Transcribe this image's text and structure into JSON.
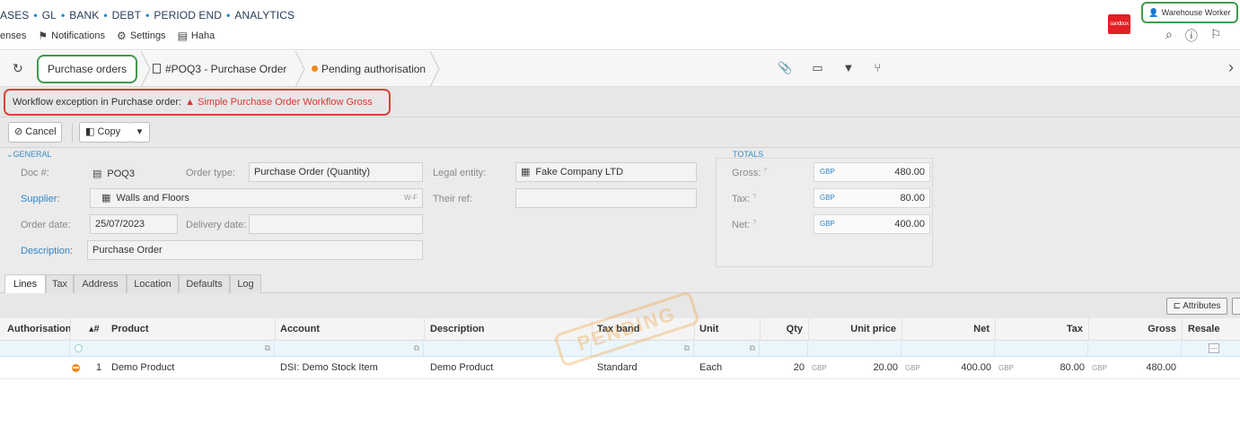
{
  "topnav": {
    "modules": [
      "ASES",
      "GL",
      "BANK",
      "DEBT",
      "PERIOD END",
      "ANALYTICS"
    ],
    "links": [
      {
        "label": "enses",
        "icon": ""
      },
      {
        "label": "Notifications",
        "icon": "flag-icon"
      },
      {
        "label": "Settings",
        "icon": "gear-icon"
      },
      {
        "label": "Haha",
        "icon": "document-icon"
      }
    ],
    "logo_text": "sandbox-laes",
    "user_label": "Warehouse Worker"
  },
  "breadcrumb": {
    "root": "Purchase orders",
    "document": "#POQ3 - Purchase Order",
    "status": "Pending authorisation"
  },
  "exception": {
    "prefix": "Workflow exception in Purchase order:",
    "link": "Simple Purchase Order Workflow Gross"
  },
  "actions": {
    "cancel": "Cancel",
    "copy": "Copy"
  },
  "general": {
    "section": "GENERAL",
    "doc_label": "Doc #:",
    "doc_value": "POQ3",
    "order_type_label": "Order type:",
    "order_type_value": "Purchase Order (Quantity)",
    "legal_entity_label": "Legal entity:",
    "legal_entity_value": "Fake Company LTD",
    "supplier_label": "Supplier:",
    "supplier_value": "Walls and Floors",
    "supplier_code": "W-F",
    "their_ref_label": "Their ref:",
    "their_ref_value": "",
    "order_date_label": "Order date:",
    "order_date_value": "25/07/2023",
    "delivery_date_label": "Delivery date:",
    "delivery_date_value": "",
    "description_label": "Description:",
    "description_value": "Purchase Order"
  },
  "totals": {
    "section": "TOTALS",
    "gross_label": "Gross:",
    "tax_label": "Tax:",
    "net_label": "Net:",
    "currency": "GBP",
    "gross_value": "480.00",
    "tax_value": "80.00",
    "net_value": "400.00",
    "help_mark": "?"
  },
  "tabs": [
    "Lines",
    "Tax",
    "Address",
    "Location",
    "Defaults",
    "Log"
  ],
  "grid": {
    "attributes_button": "Attributes",
    "columns": {
      "authorisation": "Authorisation",
      "num": "▴#",
      "product": "Product",
      "account": "Account",
      "description": "Description",
      "tax_band": "Tax band",
      "unit": "Unit",
      "qty": "Qty",
      "unit_price": "Unit price",
      "net": "Net",
      "tax": "Tax",
      "gross": "Gross",
      "resale": "Resale"
    },
    "rows": [
      {
        "num": "1",
        "product": "Demo Product",
        "account": "DSI: Demo Stock Item",
        "description": "Demo Product",
        "tax_band": "Standard",
        "unit": "Each",
        "qty": "20",
        "currency": "GBP",
        "unit_price": "20.00",
        "net": "400.00",
        "tax": "80.00",
        "gross": "480.00"
      }
    ],
    "stamp": "PENDING"
  }
}
